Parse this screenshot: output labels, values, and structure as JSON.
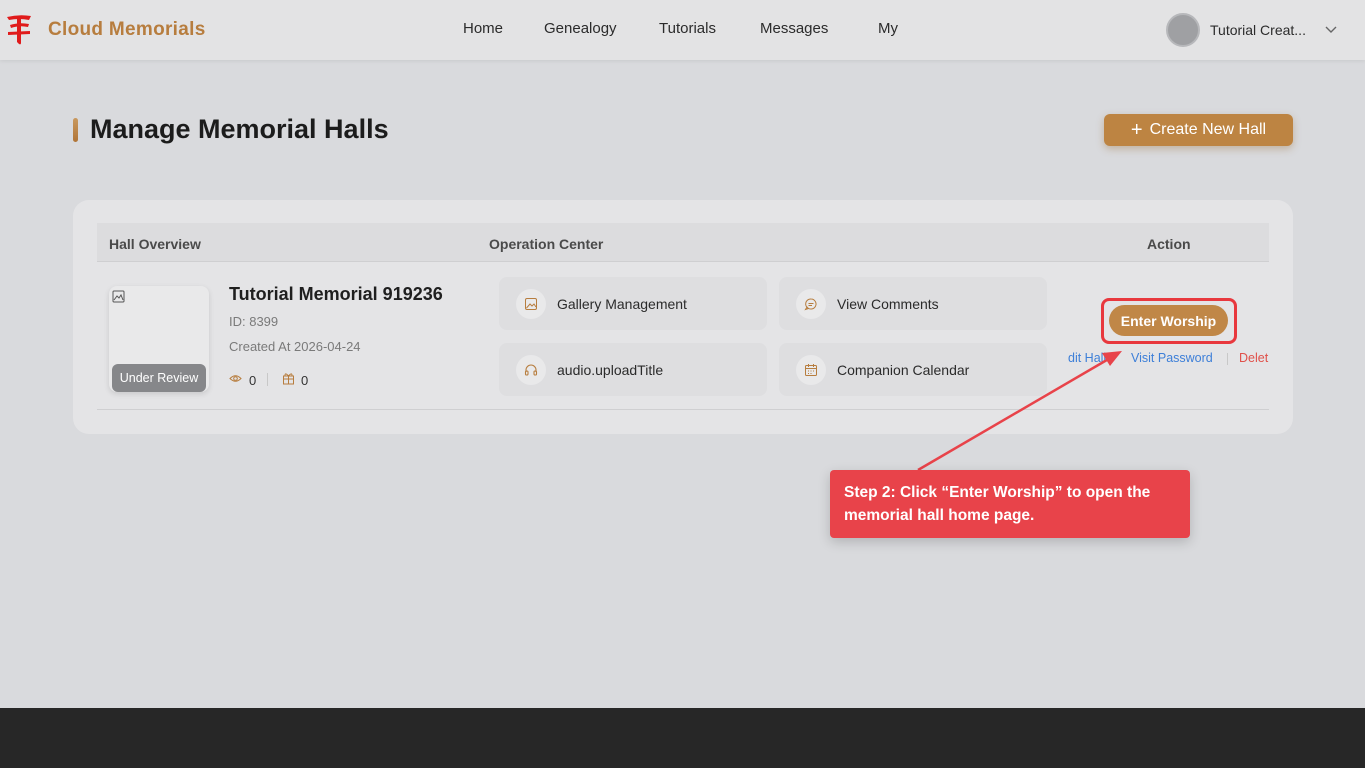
{
  "brand": {
    "name": "Cloud Memorials",
    "logo_icon": "red-cloud-logo",
    "color": "#b77d3e"
  },
  "nav": [
    {
      "label": "Home"
    },
    {
      "label": "Genealogy"
    },
    {
      "label": "Tutorials"
    },
    {
      "label": "Messages"
    },
    {
      "label": "My"
    }
  ],
  "user": {
    "name": "Tutorial Creat...",
    "avatar_icon": "avatar",
    "dropdown_icon": "chevron-down-icon"
  },
  "page": {
    "title": "Manage Memorial Halls",
    "create_button": "Create New Hall"
  },
  "table": {
    "headers": {
      "overview": "Hall Overview",
      "operations": "Operation Center",
      "action": "Action"
    },
    "rows": [
      {
        "status": "Under Review",
        "name": "Tutorial Memorial 919236",
        "id": "ID: 8399",
        "created": "Created At 2026-04-24",
        "views": "0",
        "gifts": "0",
        "operations": [
          {
            "label": "Gallery Management",
            "icon": "image-icon"
          },
          {
            "label": "View Comments",
            "icon": "comment-icon"
          },
          {
            "label": "audio.uploadTitle",
            "icon": "headphones-icon"
          },
          {
            "label": "Companion Calendar",
            "icon": "calendar-icon"
          }
        ],
        "actions": {
          "enter": "Enter Worship",
          "edit": "dit Hall",
          "password": "Visit Password",
          "delete": "Delet"
        }
      }
    ]
  },
  "annotation": {
    "text": "Step 2: Click “Enter Worship” to open the memorial hall home page.",
    "color": "#e8434a"
  }
}
